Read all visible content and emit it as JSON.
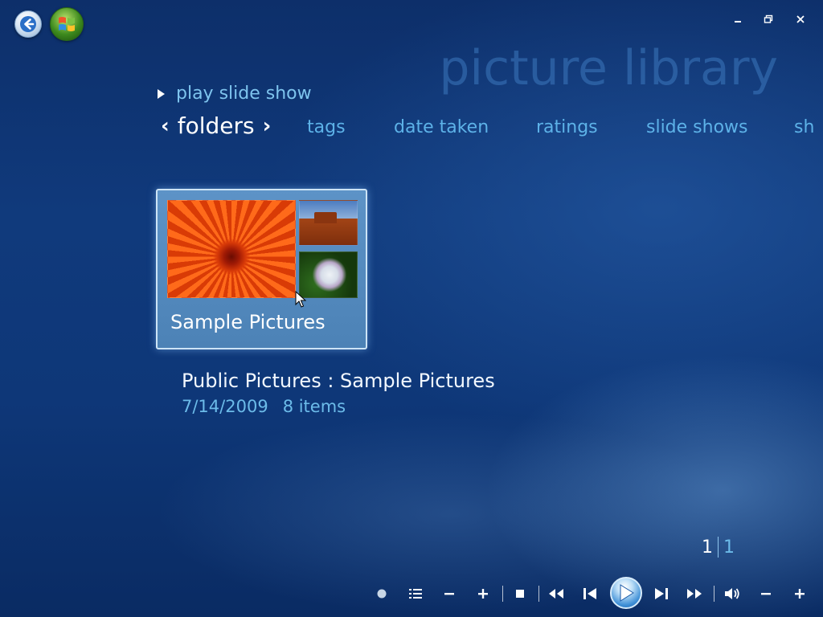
{
  "window": {
    "title": "picture library",
    "controls": {
      "minimize": "minimize-icon",
      "restore": "restore-icon",
      "close": "close-icon"
    }
  },
  "actions": {
    "play_slide_show": "play slide show"
  },
  "nav": {
    "active": "folders",
    "items": [
      "tags",
      "date taken",
      "ratings",
      "slide shows",
      "sh"
    ]
  },
  "folder": {
    "label": "Sample Pictures",
    "thumbnails": [
      "flower-photo",
      "desert-photo",
      "hydrangea-photo"
    ]
  },
  "details": {
    "title": "Public Pictures : Sample Pictures",
    "date": "7/14/2009",
    "count": "8 items"
  },
  "pagination": {
    "current": "1",
    "total": "1"
  },
  "transport": {
    "buttons": [
      "record",
      "guide",
      "channel-minus",
      "channel-plus",
      "stop",
      "rewind",
      "previous",
      "play",
      "next",
      "fast-forward",
      "mute",
      "volume-minus",
      "volume-plus"
    ]
  },
  "colors": {
    "background": "#103a7c",
    "accent": "#5db2e8",
    "title": "#3c78be",
    "tile": "#5d93c7"
  }
}
